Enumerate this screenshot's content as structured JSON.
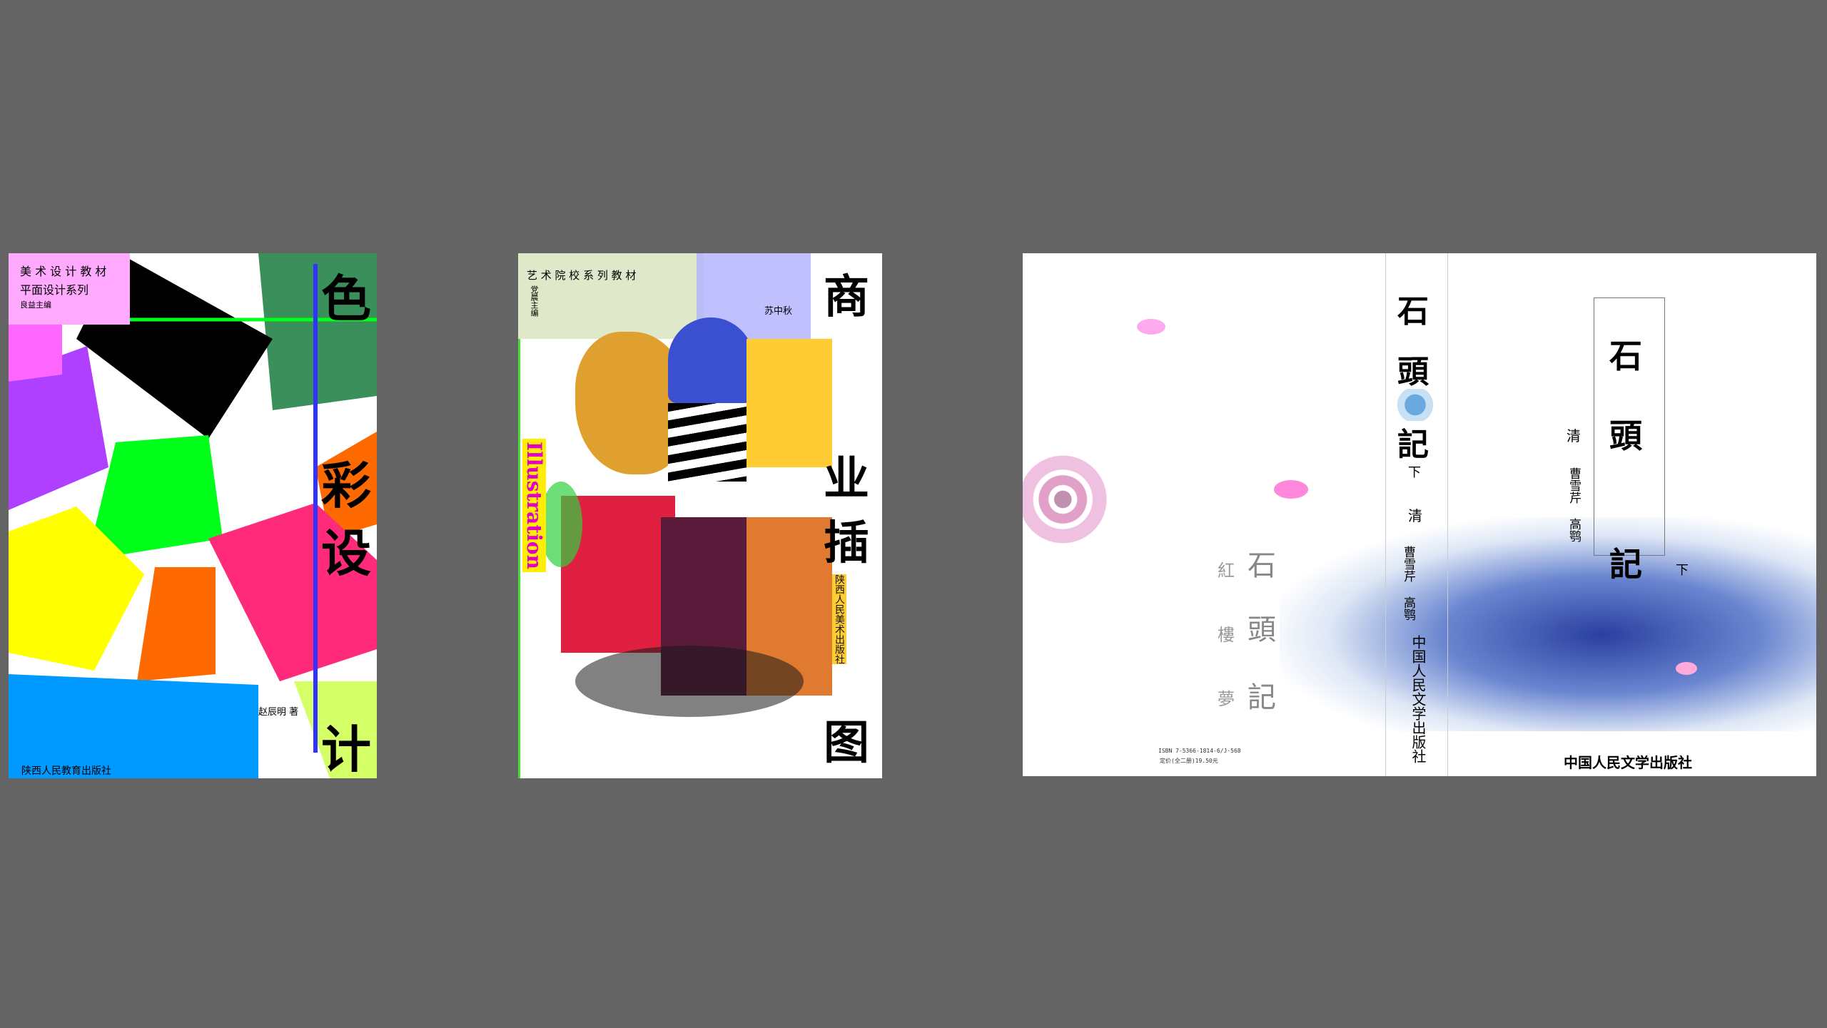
{
  "cover1": {
    "series_line1": "美 术 设 计 教 材",
    "series_line2": "平面设计系列",
    "editor": "良益主编",
    "title_chars": [
      "色",
      "彩",
      "设",
      "计"
    ],
    "author": "赵辰明 著",
    "publisher": "陕西人民教育出版社",
    "colors": {
      "green": "#3a8f5a",
      "black": "#000000",
      "purple": "#b040ff",
      "lime": "#00ff1a",
      "yellow": "#ffff00",
      "orange": "#ff6a00",
      "pink": "#ff2a7a",
      "blue": "#0099ff",
      "lavender": "#ff66ff",
      "limepale": "#d4ff66"
    }
  },
  "cover2": {
    "series": "艺 术 院 校 系 列 教 材",
    "editor": "党晨主编",
    "author": "苏中秋",
    "title_chars": [
      "商",
      "业",
      "插",
      "图"
    ],
    "vertical_word": "Illustration",
    "spine_publisher": "陕西人民美术出版社",
    "colors": {
      "magenta": "#e000c8",
      "yellowtext": "#ffee00"
    }
  },
  "cover3": {
    "back_title_chars": [
      "石",
      "頭",
      "記"
    ],
    "back_subtitle_chars": [
      "紅",
      "樓",
      "夢"
    ],
    "isbn": "ISBN 7-5366-1814-6/J·568",
    "price": "定价(全二册)19.50元",
    "spine_title_chars": [
      "石",
      "頭",
      "記"
    ],
    "spine_volume": "下",
    "spine_dynasty": "清",
    "spine_author": "曹雪芹 高鹗",
    "spine_publisher": "中国人民文学出版社",
    "front_title_chars": [
      "石",
      "頭",
      "記"
    ],
    "front_dynasty": "清",
    "front_author": "曹雪芹 高鹗",
    "front_volume": "下",
    "front_publisher": "中国人民文学出版社"
  }
}
